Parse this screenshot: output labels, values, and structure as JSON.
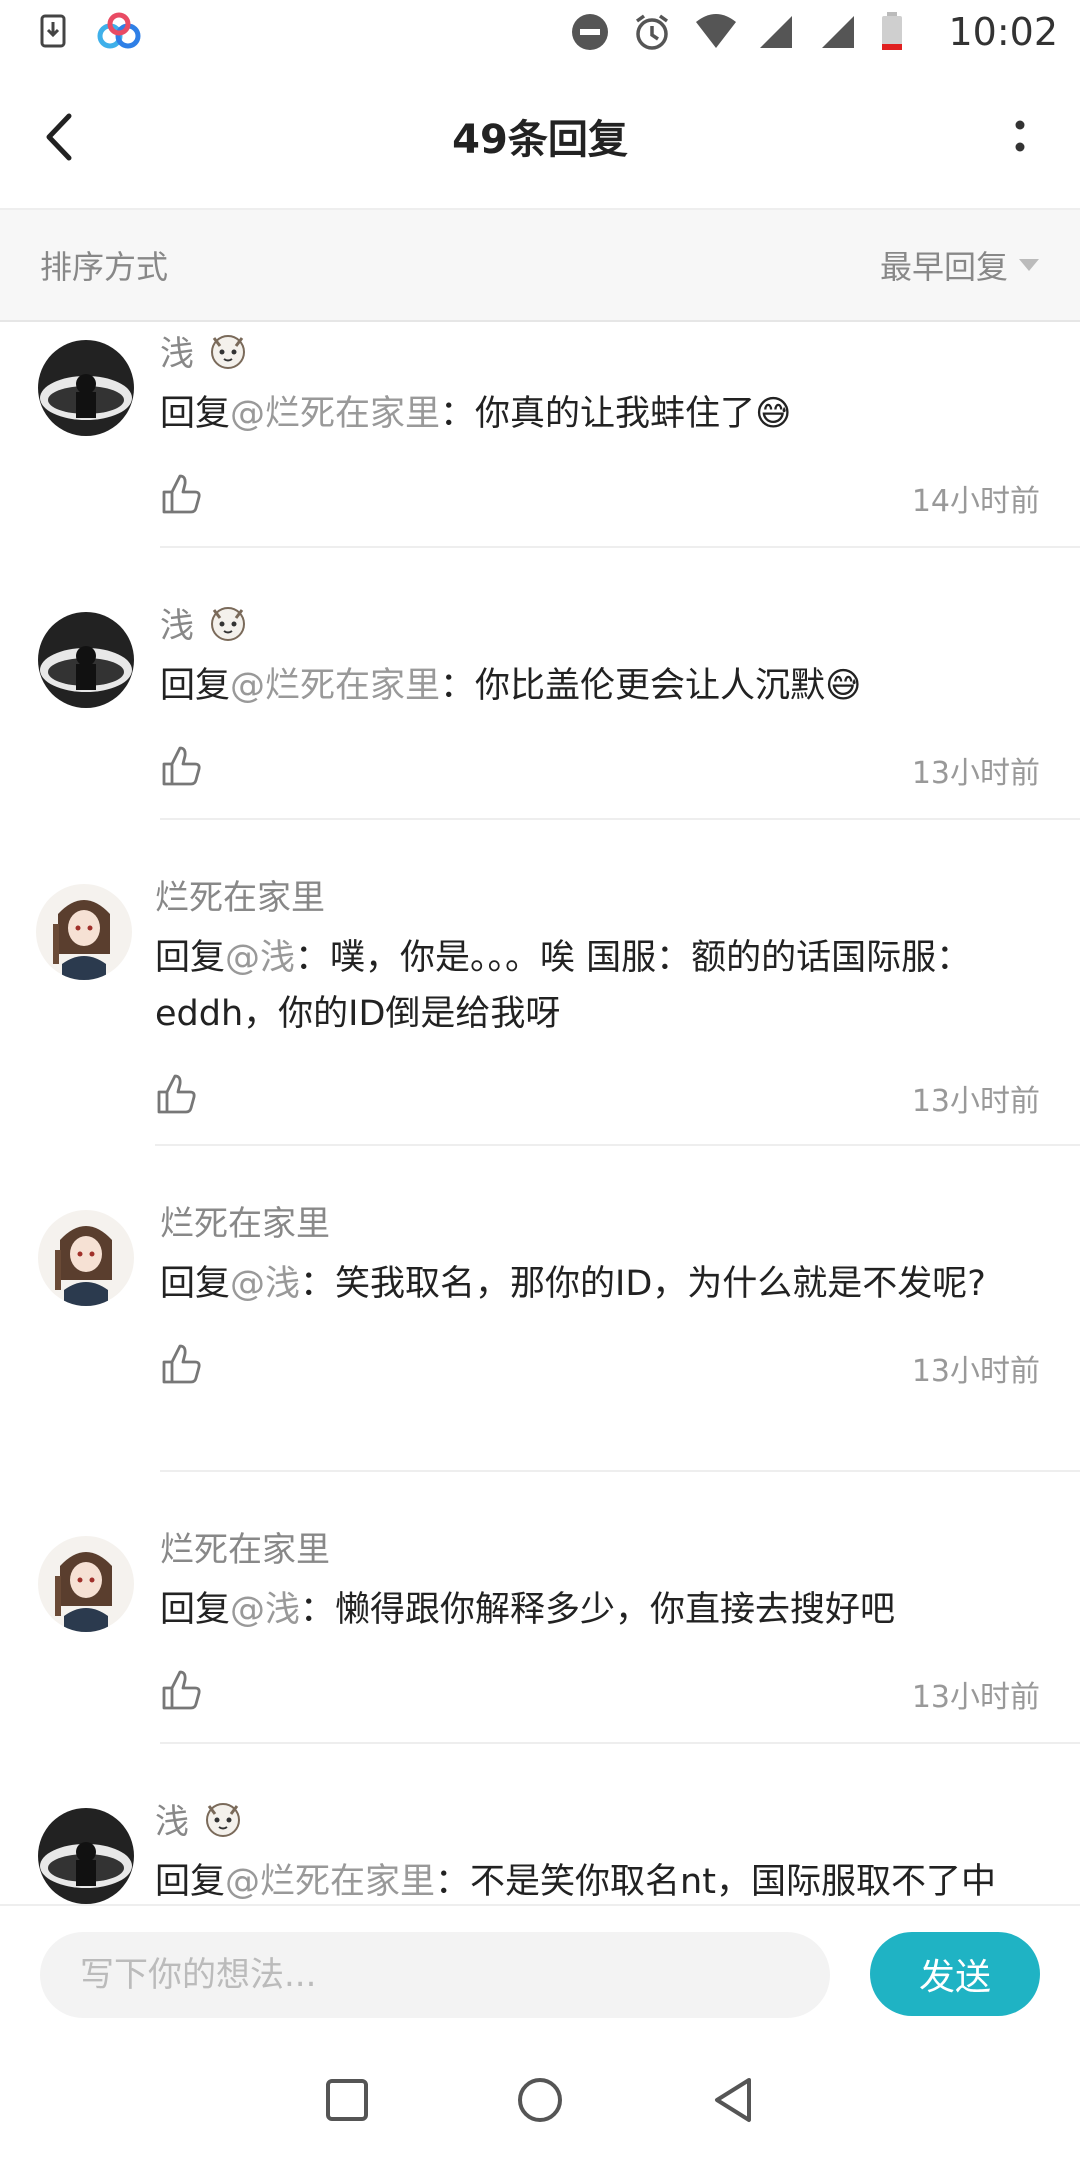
{
  "status_bar": {
    "time": "10:02",
    "icons": [
      "download-icon",
      "baidu-cloud-icon",
      "dnd-icon",
      "alarm-icon",
      "wifi-icon",
      "signal-icon",
      "signal-icon-2",
      "battery-low-icon"
    ]
  },
  "header": {
    "title": "49条回复",
    "back_icon": "chevron-left-icon",
    "more_icon": "more-vertical-icon"
  },
  "sort": {
    "label": "排序方式",
    "value": "最早回复"
  },
  "replies": [
    {
      "user": "浅",
      "has_badge": true,
      "prefix": "回复",
      "mention": "@烂死在家里",
      "text": "：你真的让我蚌住了😅",
      "time": "14小时前"
    },
    {
      "user": "浅",
      "has_badge": true,
      "prefix": "回复",
      "mention": "@烂死在家里",
      "text": "：你比盖伦更会让人沉默😅",
      "time": "13小时前"
    },
    {
      "user": "烂死在家里",
      "has_badge": false,
      "prefix": "回复",
      "mention": "@浅",
      "text": "：噗，你是。。。唉 国服：额的的话国际服：eddh，你的ID倒是给我呀",
      "time": "13小时前"
    },
    {
      "user": "烂死在家里",
      "has_badge": false,
      "prefix": "回复",
      "mention": "@浅",
      "text": "：笑我取名，那你的ID，为什么就是不发呢?",
      "time": "13小时前"
    },
    {
      "user": "烂死在家里",
      "has_badge": false,
      "prefix": "回复",
      "mention": "@浅",
      "text": "：懒得跟你解释多少，你直接去搜好吧",
      "time": "13小时前"
    },
    {
      "user": "浅",
      "has_badge": true,
      "prefix": "回复",
      "mention": "@烂死在家里",
      "text": "：不是笑你取名nt，国际服取不了中",
      "time": ""
    }
  ],
  "input": {
    "placeholder": "写下你的想法...",
    "send_label": "发送"
  },
  "colors": {
    "accent": "#1fb3c4",
    "text_primary": "#222222",
    "text_secondary": "#888888",
    "mention": "#999999"
  }
}
